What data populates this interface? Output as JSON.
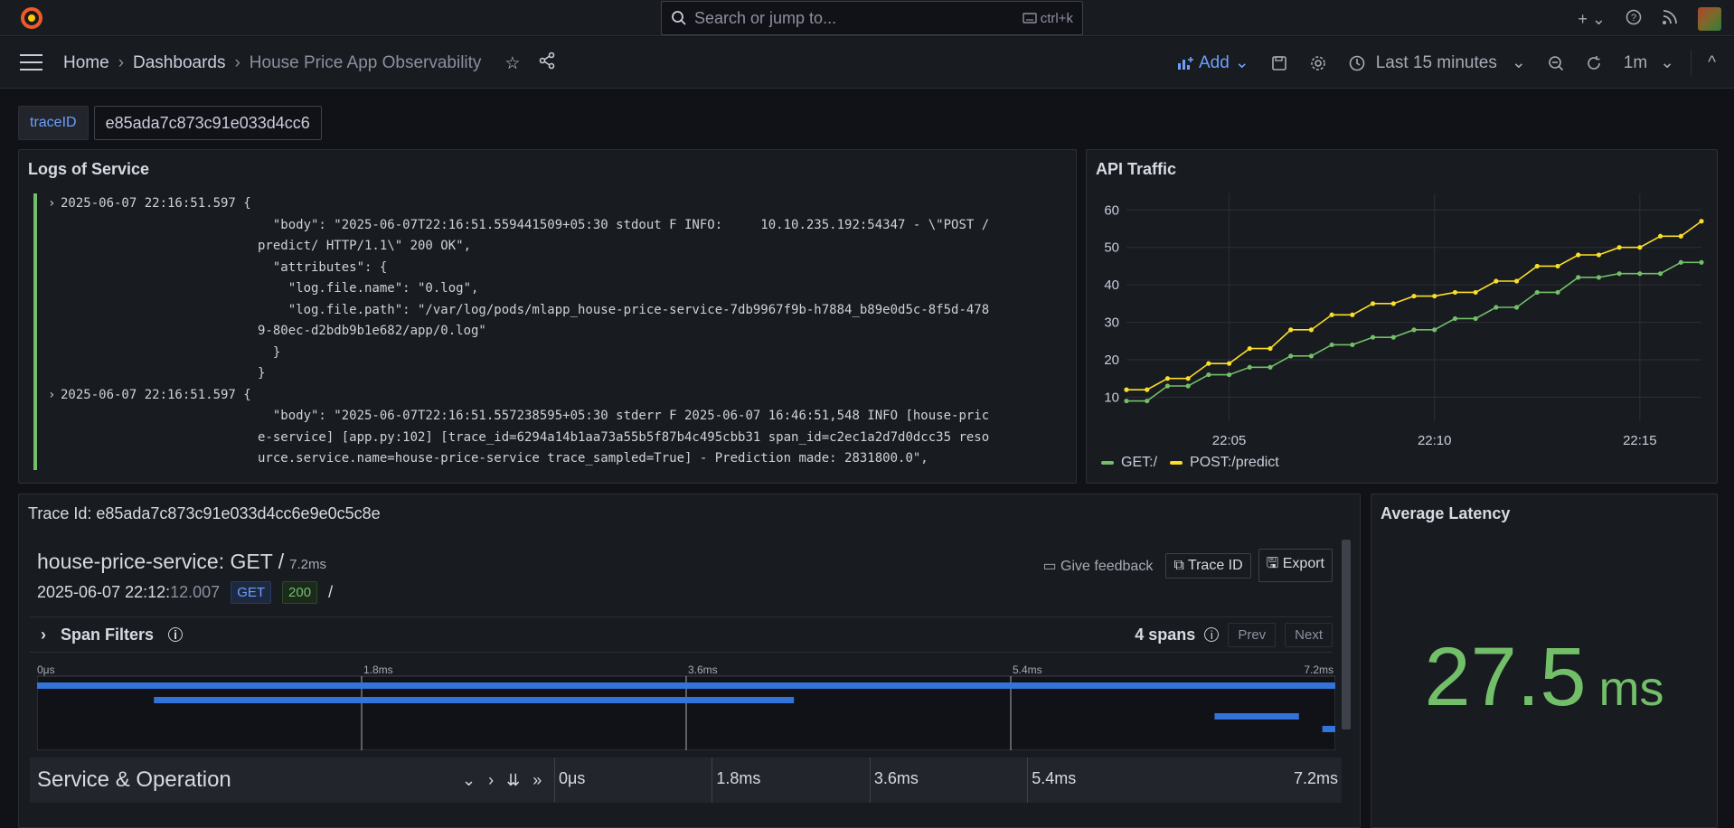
{
  "topbar": {
    "search_placeholder": "Search or jump to...",
    "search_shortcut": "ctrl+k",
    "icons": [
      "plus-icon",
      "help-icon",
      "news-icon",
      "avatar"
    ]
  },
  "breadcrumb": {
    "home": "Home",
    "dashboards": "Dashboards",
    "current": "House Price App Observability"
  },
  "toolbar": {
    "add_label": "Add",
    "time_range": "Last 15 minutes",
    "refresh_interval": "1m"
  },
  "variables": {
    "label": "traceID",
    "value": "e85ada7c873c91e033d4cc6"
  },
  "logs_panel": {
    "title": "Logs of Service",
    "entries": [
      {
        "timestamp": "2025-06-07 22:16:51.597 {",
        "lines": [
          "  \"body\": \"2025-06-07T22:16:51.559441509+05:30 stdout F INFO:     10.10.235.192:54347 - \\\"POST /",
          "predict/ HTTP/1.1\\\" 200 OK\",",
          "  \"attributes\": {",
          "    \"log.file.name\": \"0.log\",",
          "    \"log.file.path\": \"/var/log/pods/mlapp_house-price-service-7db9967f9b-h7884_b89e0d5c-8f5d-478",
          "9-80ec-d2bdb9b1e682/app/0.log\"",
          "  }",
          "}"
        ]
      },
      {
        "timestamp": "2025-06-07 22:16:51.597 {",
        "lines": [
          "  \"body\": \"2025-06-07T22:16:51.557238595+05:30 stderr F 2025-06-07 16:46:51,548 INFO [house-pric",
          "e-service] [app.py:102] [trace_id=6294a14b1aa73a55b5f87b4c495cbb31 span_id=c2ec1a2d7d0dcc35 reso",
          "urce.service.name=house-price-service trace_sampled=True] - Prediction made: 2831800.0\","
        ]
      }
    ]
  },
  "api_traffic": {
    "title": "API Traffic"
  },
  "chart_data": {
    "type": "line",
    "title": "API Traffic",
    "x": [
      "22:02:30",
      "22:03:00",
      "22:03:30",
      "22:04:00",
      "22:04:30",
      "22:05:00",
      "22:05:30",
      "22:06:00",
      "22:06:30",
      "22:07:00",
      "22:07:30",
      "22:08:00",
      "22:08:30",
      "22:09:00",
      "22:09:30",
      "22:10:00",
      "22:10:30",
      "22:11:00",
      "22:11:30",
      "22:12:00",
      "22:12:30",
      "22:13:00",
      "22:13:30",
      "22:14:00",
      "22:14:30",
      "22:15:00",
      "22:15:30",
      "22:16:00",
      "22:16:30"
    ],
    "xticks": [
      "22:05",
      "22:10",
      "22:15"
    ],
    "yticks": [
      10,
      20,
      30,
      40,
      50,
      60
    ],
    "ylim": [
      6,
      62
    ],
    "series": [
      {
        "name": "GET:/",
        "color": "#73bf69",
        "values": [
          9,
          9,
          13,
          13,
          16,
          16,
          18,
          18,
          21,
          21,
          24,
          24,
          26,
          26,
          28,
          28,
          31,
          31,
          34,
          34,
          38,
          38,
          42,
          42,
          43,
          43,
          43,
          46,
          46
        ]
      },
      {
        "name": "POST:/predict",
        "color": "#fade2a",
        "values": [
          12,
          12,
          15,
          15,
          19,
          19,
          23,
          23,
          28,
          28,
          32,
          32,
          35,
          35,
          37,
          37,
          38,
          38,
          41,
          41,
          45,
          45,
          48,
          48,
          50,
          50,
          53,
          53,
          57
        ]
      }
    ],
    "legend_position": "bottom-left",
    "grid": true
  },
  "trace_panel": {
    "title": "Trace Id: e85ada7c873c91e033d4cc6e9e0c5c8e",
    "header": "house-price-service: GET /",
    "duration": "7.2ms",
    "start_date": "2025-06-07 22:12:",
    "start_secs": "12.007",
    "method": "GET",
    "status": "200",
    "path": "/",
    "feedback_label": "Give feedback",
    "trace_id_button": "Trace ID",
    "export_button": "Export",
    "span_filters_label": "Span Filters",
    "span_count": "4 spans",
    "prev_label": "Prev",
    "next_label": "Next",
    "minimap_ticks": [
      "0μs",
      "1.8ms",
      "3.6ms",
      "5.4ms",
      "7.2ms"
    ],
    "service_op_label": "Service & Operation",
    "header_ticks": [
      "0μs",
      "1.8ms",
      "3.6ms",
      "5.4ms",
      "7.2ms"
    ],
    "spans": [
      {
        "start": 0.0,
        "end": 1.0
      },
      {
        "start": 0.09,
        "end": 0.583
      },
      {
        "start": 0.907,
        "end": 0.972
      },
      {
        "start": 0.99,
        "end": 1.0
      }
    ]
  },
  "latency_panel": {
    "title": "Average Latency",
    "value": "27.5",
    "unit": "ms"
  }
}
